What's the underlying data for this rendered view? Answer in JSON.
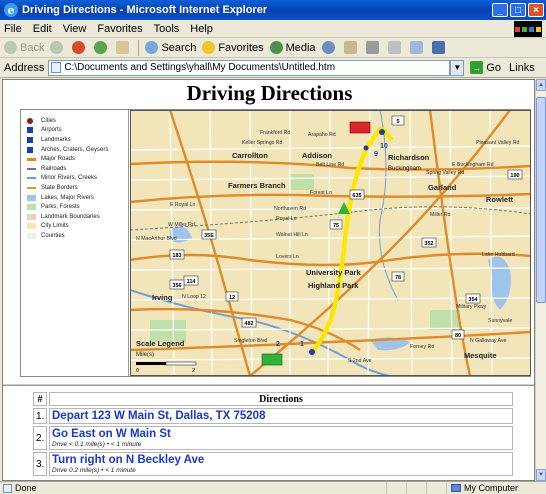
{
  "window": {
    "title": "Driving Directions - Microsoft Internet Explorer",
    "buttons": [
      "_",
      "□",
      "×"
    ]
  },
  "menu": [
    "File",
    "Edit",
    "View",
    "Favorites",
    "Tools",
    "Help"
  ],
  "toolbar": {
    "back": "Back",
    "search": "Search",
    "favorites": "Favorites",
    "media": "Media"
  },
  "address": {
    "label": "Address",
    "value": "C:\\Documents and Settings\\yhall\\My Documents\\Untitled.htm",
    "go": "Go",
    "links": "Links"
  },
  "page": {
    "title": "Driving Directions"
  },
  "legend": [
    {
      "label": "Cities",
      "color": "#8b1a1a"
    },
    {
      "label": "Airports",
      "color": "#1a3fa8"
    },
    {
      "label": "Landmarks",
      "color": "#1a3fa8"
    },
    {
      "label": "Arches, Craters, Geysers",
      "color": "#1a3fa8"
    },
    {
      "label": "Major Roads",
      "color": "#e08a2a"
    },
    {
      "label": "Railroads",
      "color": "#777777"
    },
    {
      "label": "Minor Rivers, Creeks",
      "color": "#6f9fd8"
    },
    {
      "label": "State Borders",
      "color": "#c9a61a"
    },
    {
      "label": "Lakes, Major Rivers",
      "color": "#9fc3ea"
    },
    {
      "label": "Parks, Forests",
      "color": "#bfe0a8"
    },
    {
      "label": "Landmark Boundaries",
      "color": "#e5d3c6"
    },
    {
      "label": "City Limits",
      "color": "#f6e6b3"
    },
    {
      "label": "Counties",
      "color": "#f3efe0"
    }
  ],
  "map": {
    "cities": [
      "Carrollton",
      "Richardson",
      "Garland",
      "Rowlett",
      "Farmers Branch",
      "Irving",
      "University Park",
      "Highland Park",
      "Mesquite",
      "Addison",
      "Buckingham"
    ],
    "roads": [
      "Arapaho Rd",
      "Belt Line Rd",
      "Frankford Rd",
      "Keller Springs Rd",
      "Forest Ln",
      "Northaven Rd",
      "Royal Ln",
      "Walnut Hill Ln",
      "Lovers Ln",
      "Miller Rd",
      "Singleton Blvd",
      "N Loop 12",
      "S 2nd Ave",
      "Forney Rd",
      "N Galloway Ave",
      "E Buckingham Rd",
      "Pleasant Valley Rd",
      "Lake Hubbard",
      "Military Pkwy",
      "Sunnyvale",
      "E Royal Ln",
      "Spring Valley Rd",
      "W Miller Rd",
      "N MacArthur Blvd"
    ],
    "highways": [
      "75",
      "635",
      "35E",
      "12",
      "183",
      "114",
      "78",
      "352",
      "80",
      "190",
      "5",
      "356",
      "482",
      "354"
    ],
    "waypoints": [
      "1",
      "2",
      "9",
      "10"
    ],
    "scale_label": "Scale Legend",
    "scale_units": "Mile(s)",
    "scale_ticks": [
      "0",
      "2"
    ]
  },
  "directions": {
    "header_num": "#",
    "header": "Directions",
    "steps": [
      {
        "num": "1.",
        "text": "Depart 123 W Main St, Dallas, TX 75208",
        "sub": ""
      },
      {
        "num": "2.",
        "text": "Go East on W Main St",
        "sub": "Drive < 0.1 mile(s) • < 1 minute"
      },
      {
        "num": "3.",
        "text": "Turn right on N Beckley Ave",
        "sub": "Drive 0.2 mile(s) • < 1 minute"
      }
    ]
  },
  "status": {
    "text": "Done",
    "zone": "My Computer"
  }
}
